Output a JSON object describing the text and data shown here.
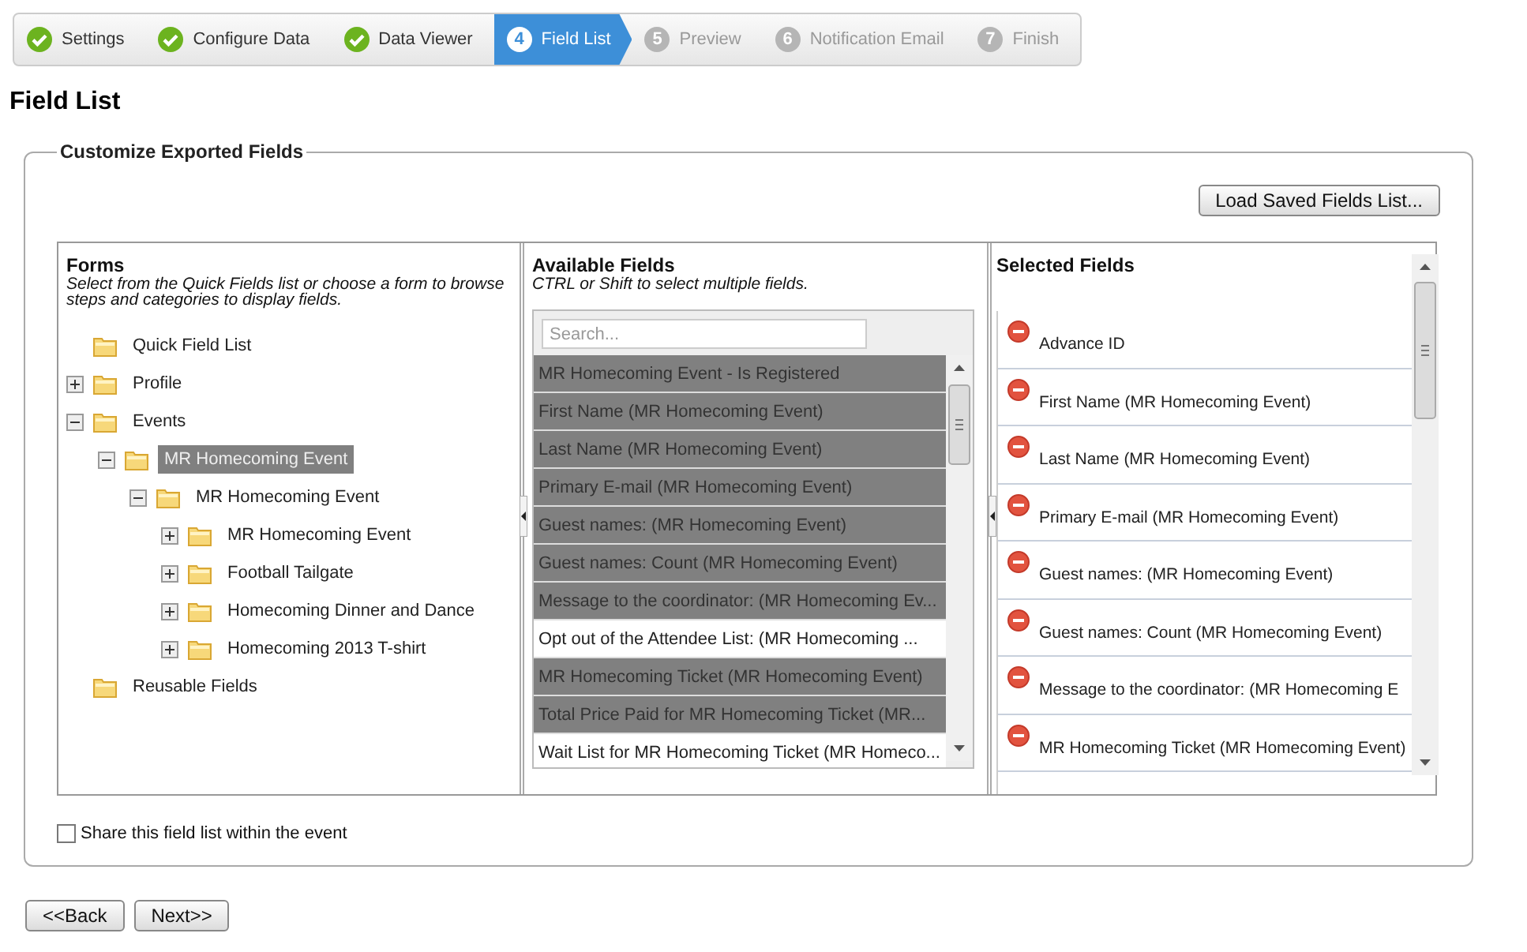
{
  "wizard": {
    "steps": [
      {
        "label": "Settings",
        "completed": true,
        "selected": false
      },
      {
        "label": "Configure Data",
        "completed": true,
        "selected": false
      },
      {
        "label": "Data Viewer",
        "completed": true,
        "selected": false
      },
      {
        "number": "4",
        "label": "Field List",
        "completed": false,
        "selected": true
      },
      {
        "number": "5",
        "label": "Preview",
        "completed": false,
        "selected": false
      },
      {
        "number": "6",
        "label": "Notification Email",
        "completed": false,
        "selected": false
      },
      {
        "number": "7",
        "label": "Finish",
        "completed": false,
        "selected": false
      }
    ]
  },
  "page_title": "Field List",
  "fieldset": {
    "legend": "Customize Exported Fields",
    "load_button": "Load Saved Fields List..."
  },
  "forms_panel": {
    "title": "Forms",
    "hint": "Select from the Quick Fields list or choose a form to browse steps and categories to display fields.",
    "tree": [
      {
        "label": "Quick Field List",
        "selected": false
      },
      {
        "label": "Profile",
        "expanded": false,
        "selected": false
      },
      {
        "label": "Events",
        "expanded": true,
        "selected": false,
        "children": [
          {
            "label": "MR Homecoming Event",
            "expanded": true,
            "selected": true,
            "children": [
              {
                "label": "MR Homecoming Event",
                "expanded": true,
                "selected": false,
                "children": [
                  {
                    "label": "MR Homecoming Event",
                    "expanded": false,
                    "selected": false
                  },
                  {
                    "label": "Football Tailgate",
                    "expanded": false,
                    "selected": false
                  },
                  {
                    "label": "Homecoming Dinner and Dance",
                    "expanded": false,
                    "selected": false
                  },
                  {
                    "label": "Homecoming 2013 T-shirt",
                    "expanded": false,
                    "selected": false
                  }
                ]
              }
            ]
          }
        ]
      },
      {
        "label": "Reusable Fields",
        "selected": false
      }
    ]
  },
  "available_panel": {
    "title": "Available Fields",
    "hint": "CTRL or Shift to select multiple fields.",
    "search": {
      "placeholder": "Search..."
    },
    "fields": [
      {
        "label": "MR Homecoming Event - Is Registered",
        "selected": true
      },
      {
        "label": "First Name (MR Homecoming Event)",
        "selected": true
      },
      {
        "label": "Last Name (MR Homecoming Event)",
        "selected": true
      },
      {
        "label": "Primary E-mail (MR Homecoming Event)",
        "selected": true
      },
      {
        "label": "Guest names: (MR Homecoming Event)",
        "selected": true
      },
      {
        "label": "Guest names: Count (MR Homecoming Event)",
        "selected": true
      },
      {
        "label": "Message to the coordinator: (MR Homecoming Ev...",
        "selected": true
      },
      {
        "label": "Opt out of the Attendee List: (MR Homecoming ...",
        "selected": false
      },
      {
        "label": "MR Homecoming Ticket (MR Homecoming Event)",
        "selected": true
      },
      {
        "label": "Total Price Paid for MR Homecoming Ticket (MR...",
        "selected": true
      },
      {
        "label": "Wait List for MR Homecoming Ticket (MR Homeco...",
        "selected": false
      }
    ]
  },
  "selected_panel": {
    "title": "Selected Fields",
    "fields": [
      "Advance ID",
      "First Name (MR Homecoming Event)",
      "Last Name (MR Homecoming Event)",
      "Primary E-mail (MR Homecoming Event)",
      "Guest names: (MR Homecoming Event)",
      "Guest names: Count (MR Homecoming Event)",
      "Message to the coordinator: (MR Homecoming E",
      "MR Homecoming Ticket (MR Homecoming Event)"
    ]
  },
  "share": {
    "label": "Share this field list within the event",
    "checked": false
  },
  "buttons": [
    "<<Back",
    "Next>>"
  ]
}
